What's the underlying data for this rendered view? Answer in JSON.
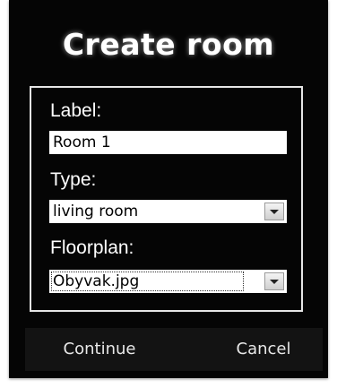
{
  "dialog": {
    "title": "Create room",
    "fields": {
      "label": {
        "label": "Label:",
        "value": "Room 1"
      },
      "type": {
        "label": "Type:",
        "selected": "living room"
      },
      "floorplan": {
        "label": "Floorplan:",
        "selected": "Obyvak.jpg"
      }
    },
    "buttons": {
      "continue": "Continue",
      "cancel": "Cancel"
    }
  },
  "colors": {
    "dialog_background": "#050505",
    "text": "#ffffff",
    "panel_border": "#e6e6e6",
    "button_bar": "#131313"
  },
  "icons": {
    "dropdown_arrow": "chevron-down-icon"
  }
}
